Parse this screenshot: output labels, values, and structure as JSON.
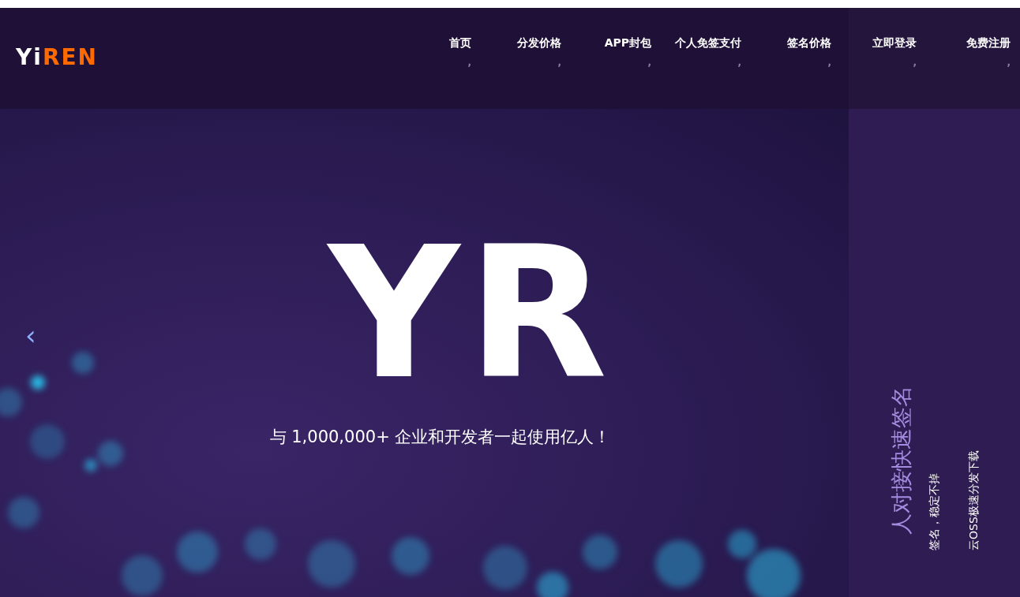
{
  "header": {
    "logo": {
      "light": "Yi",
      "accent": "REN"
    },
    "nav": [
      {
        "label": "首页",
        "mark": ","
      },
      {
        "label": "分发价格",
        "mark": ","
      },
      {
        "label": "APP封包",
        "mark": ","
      },
      {
        "label": "个人免签支付",
        "mark": ","
      },
      {
        "label": "签名价格",
        "mark": ","
      },
      {
        "label": "立即登录",
        "mark": ","
      },
      {
        "label": "免费注册",
        "mark": ","
      }
    ]
  },
  "hero": {
    "prev": "‹",
    "title": "YR",
    "subtitle": "与 1,000,000+ 企业和开发者一起使用亿人！"
  },
  "side_panel": {
    "headline": "人对接快速签名",
    "lines": [
      "签名，稳定不掉",
      "云OSS极速分发下载"
    ]
  }
}
